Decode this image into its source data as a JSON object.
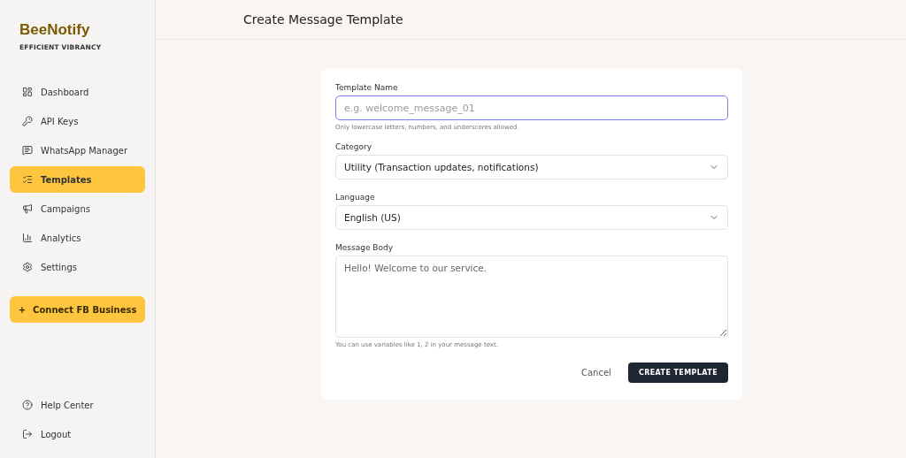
{
  "brand": {
    "name": "BeeNotify",
    "tagline": "EFFICIENT VIBRANCY"
  },
  "nav": [
    {
      "label": "Dashboard",
      "selected": false
    },
    {
      "label": "API Keys",
      "selected": false
    },
    {
      "label": "WhatsApp Manager",
      "selected": false
    },
    {
      "label": "Templates",
      "selected": true
    },
    {
      "label": "Campaigns",
      "selected": false
    },
    {
      "label": "Analytics",
      "selected": false
    },
    {
      "label": "Settings",
      "selected": false
    }
  ],
  "connect_button": {
    "icon": "+",
    "label": "Connect FB Business"
  },
  "footer_nav": [
    {
      "label": "Help Center"
    },
    {
      "label": "Logout"
    }
  ],
  "page_title": "Create Message Template",
  "form": {
    "template_name": {
      "label": "Template Name",
      "placeholder": "e.g. welcome_message_01",
      "hint": "Only lowercase letters, numbers, and underscores allowed."
    },
    "category": {
      "label": "Category",
      "value": "Utility (Transaction updates, notifications)"
    },
    "language": {
      "label": "Language",
      "value": "English (US)"
    },
    "message_body": {
      "label": "Message Body",
      "value": "Hello! Welcome to our service.",
      "hint": "You can use variables like 1, 2 in your message text."
    },
    "buttons": {
      "cancel": "Cancel",
      "submit": "CREATE TEMPLATE"
    }
  }
}
